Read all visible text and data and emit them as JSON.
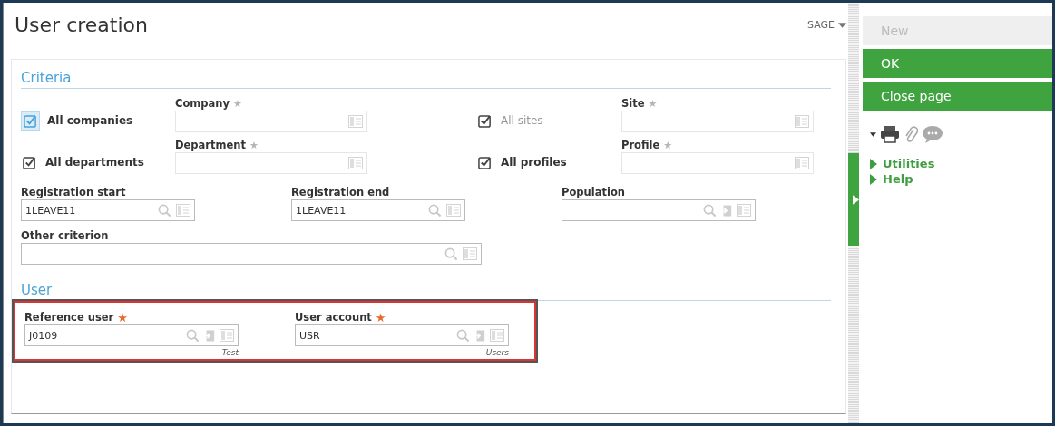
{
  "title": "User creation",
  "user_menu": "SAGE",
  "criteria": {
    "heading": "Criteria",
    "rows": [
      {
        "checkbox": {
          "label": "All companies",
          "checked": true,
          "disabled": false,
          "focused": true
        },
        "field": {
          "label": "Company",
          "star": "★",
          "mandatory": false,
          "kind": "plain"
        }
      },
      {
        "checkbox": {
          "label": "All sites",
          "checked": true,
          "disabled": true,
          "focused": false
        },
        "field": {
          "label": "Site",
          "star": "★",
          "mandatory": false,
          "kind": "plain"
        }
      },
      {
        "checkbox": {
          "label": "All departments",
          "checked": true,
          "disabled": false,
          "focused": false
        },
        "field": {
          "label": "Department",
          "star": "★",
          "mandatory": false,
          "kind": "plain"
        }
      },
      {
        "checkbox": {
          "label": "All profiles",
          "checked": true,
          "disabled": false,
          "focused": false
        },
        "field": {
          "label": "Profile",
          "star": "★",
          "mandatory": false,
          "kind": "plain"
        }
      }
    ],
    "fields": [
      {
        "label": "Registration start",
        "kind": "select",
        "value": "1LEAVE11"
      },
      {
        "label": "Registration end",
        "kind": "select",
        "value": "1LEAVE11"
      },
      {
        "label": "Population",
        "kind": "select-jump"
      },
      {
        "label": "Other criterion",
        "kind": "select"
      }
    ]
  },
  "user": {
    "heading": "User",
    "highlighted": true,
    "fields": [
      {
        "label": "Reference user",
        "star": "★",
        "mandatory": true,
        "kind": "select-jump",
        "value": "J0109",
        "caption": "Test"
      },
      {
        "label": "User account",
        "star": "★",
        "mandatory": true,
        "kind": "select-jump",
        "value": "USR",
        "caption": "Users"
      }
    ]
  },
  "actions": [
    {
      "label": "New",
      "disabled": true
    },
    {
      "label": "OK",
      "disabled": false
    },
    {
      "label": "Close page",
      "disabled": false
    }
  ],
  "links": [
    {
      "label": "Utilities"
    },
    {
      "label": "Help"
    }
  ]
}
